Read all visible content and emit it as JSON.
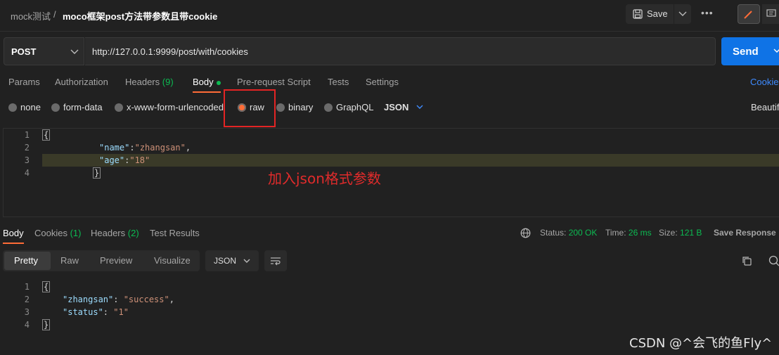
{
  "breadcrumb": {
    "workspace": "mock测试",
    "separator": "/",
    "title": "moco框架post方法带参数且带cookie"
  },
  "toolbar": {
    "save_label": "Save",
    "more_label": "•••"
  },
  "request": {
    "method": "POST",
    "url": "http://127.0.0.1:9999/post/with/cookies",
    "send_label": "Send"
  },
  "request_tabs": {
    "params": "Params",
    "authorization": "Authorization",
    "headers": "Headers",
    "headers_count": "(9)",
    "body": "Body",
    "prerequest": "Pre-request Script",
    "tests": "Tests",
    "settings": "Settings",
    "cookies": "Cookies"
  },
  "body_types": {
    "none": "none",
    "form_data": "form-data",
    "urlencoded": "x-www-form-urlencoded",
    "raw": "raw",
    "binary": "binary",
    "graphql": "GraphQL",
    "format": "JSON",
    "beautify": "Beautify"
  },
  "editor": {
    "line_numbers": [
      "1",
      "2",
      "3",
      "4"
    ],
    "key1": "\"name\"",
    "val1": "\"zhangsan\"",
    "key2": "\"age\"",
    "val2": "\"18\"",
    "open": "{",
    "close": "}"
  },
  "annotation": "加入json格式参数",
  "response_tabs": {
    "body": "Body",
    "cookies": "Cookies",
    "cookies_count": "(1)",
    "headers": "Headers",
    "headers_count": "(2)",
    "test_results": "Test Results"
  },
  "response_meta": {
    "status_label": "Status:",
    "status_value": "200 OK",
    "time_label": "Time:",
    "time_value": "26 ms",
    "size_label": "Size:",
    "size_value": "121 B",
    "save_response": "Save Response"
  },
  "response_view": {
    "pretty": "Pretty",
    "raw": "Raw",
    "preview": "Preview",
    "visualize": "Visualize",
    "format": "JSON"
  },
  "response_body": {
    "line_numbers": [
      "1",
      "2",
      "3",
      "4"
    ],
    "key1": "\"zhangsan\"",
    "val1": "\"success\"",
    "key2": "\"status\"",
    "val2": "\"1\"",
    "open": "{",
    "close": "}"
  },
  "watermark": "CSDN @^会飞的鱼Fly^",
  "colors": {
    "accent": "#ff6c37",
    "send": "#0f73e6",
    "success": "#0cbb52",
    "link": "#3e8bff",
    "annotation": "#e02b2b"
  }
}
